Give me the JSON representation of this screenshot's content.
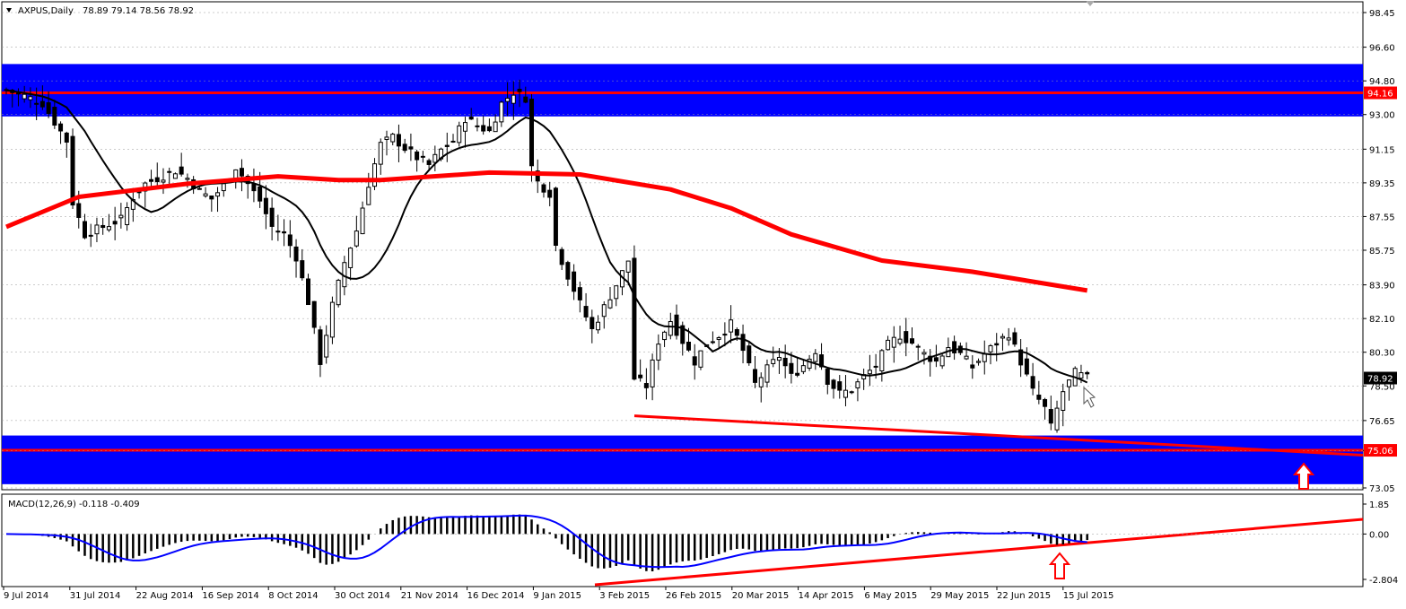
{
  "header": {
    "title": "AXPUS,Daily",
    "ohlc": "78.89 79.14 78.56 78.92",
    "macd_title": "MACD(12,26,9)",
    "macd_values": "-0.118 -0.409"
  },
  "colors": {
    "zone": "#0000ff",
    "sma_long": "#ff0000",
    "sma_short": "#000000",
    "trendline": "#ff0000",
    "macd_signal": "#0000ff",
    "histogram": "#000000",
    "arrow": "#ff0000"
  },
  "chart_data": [
    {
      "type": "candlestick",
      "name": "price",
      "ylim": [
        73.05,
        98.45
      ],
      "y_ticks": [
        "98.45",
        "96.60",
        "94.80",
        "93.00",
        "91.15",
        "89.35",
        "87.55",
        "85.75",
        "83.90",
        "82.10",
        "80.30",
        "78.50",
        "76.65",
        "75.05",
        "73.05"
      ],
      "x_ticks": [
        "9 Jul 2014",
        "31 Jul 2014",
        "22 Aug 2014",
        "16 Sep 2014",
        "8 Oct 2014",
        "30 Oct 2014",
        "21 Nov 2014",
        "16 Dec 2014",
        "9 Jan 2015",
        "3 Feb 2015",
        "26 Feb 2015",
        "20 Mar 2015",
        "14 Apr 2015",
        "6 May 2015",
        "29 May 2015",
        "22 Jun 2015",
        "15 Jul 2015"
      ],
      "last_price": "78.92",
      "levels": [
        {
          "label": "94.16",
          "value": 94.16,
          "zone": [
            92.9,
            95.7
          ]
        },
        {
          "label": "75.06",
          "value": 75.06,
          "zone": [
            73.25,
            75.85
          ]
        }
      ],
      "close_path": [
        [
          0,
          94.3
        ],
        [
          3,
          94.0
        ],
        [
          6,
          93.6
        ],
        [
          8,
          92.6
        ],
        [
          10,
          91.6
        ],
        [
          11,
          88.3
        ],
        [
          13,
          86.6
        ],
        [
          16,
          87.0
        ],
        [
          19,
          87.4
        ],
        [
          21,
          88.6
        ],
        [
          23,
          89.3
        ],
        [
          25,
          89.6
        ],
        [
          28,
          90.0
        ],
        [
          30,
          89.6
        ],
        [
          32,
          88.9
        ],
        [
          34,
          88.5
        ],
        [
          36,
          89.2
        ],
        [
          38,
          90.2
        ],
        [
          40,
          89.3
        ],
        [
          42,
          88.4
        ],
        [
          44,
          87.0
        ],
        [
          46,
          86.6
        ],
        [
          48,
          85.4
        ],
        [
          50,
          83.0
        ],
        [
          52,
          79.8
        ],
        [
          54,
          82.8
        ],
        [
          56,
          85.1
        ],
        [
          58,
          86.8
        ],
        [
          60,
          89.3
        ],
        [
          62,
          91.4
        ],
        [
          64,
          91.8
        ],
        [
          66,
          91.2
        ],
        [
          68,
          90.7
        ],
        [
          70,
          90.3
        ],
        [
          72,
          91.1
        ],
        [
          74,
          91.6
        ],
        [
          76,
          92.8
        ],
        [
          78,
          92.4
        ],
        [
          80,
          92.1
        ],
        [
          82,
          93.6
        ],
        [
          84,
          94.2
        ],
        [
          86,
          93.9
        ],
        [
          87,
          90.2
        ],
        [
          88,
          89.4
        ],
        [
          90,
          88.8
        ],
        [
          91,
          86.0
        ],
        [
          93,
          84.4
        ],
        [
          95,
          82.9
        ],
        [
          97,
          81.5
        ],
        [
          99,
          82.7
        ],
        [
          101,
          83.9
        ],
        [
          103,
          85.2
        ],
        [
          104,
          78.9
        ],
        [
          106,
          78.5
        ],
        [
          108,
          80.9
        ],
        [
          110,
          82.0
        ],
        [
          112,
          80.9
        ],
        [
          114,
          79.8
        ],
        [
          116,
          80.8
        ],
        [
          118,
          81.2
        ],
        [
          120,
          81.8
        ],
        [
          122,
          80.4
        ],
        [
          124,
          78.6
        ],
        [
          126,
          79.4
        ],
        [
          128,
          80.1
        ],
        [
          130,
          79.0
        ],
        [
          132,
          79.6
        ],
        [
          134,
          80.4
        ],
        [
          136,
          78.8
        ],
        [
          138,
          78.1
        ],
        [
          140,
          78.3
        ],
        [
          142,
          79.0
        ],
        [
          144,
          79.6
        ],
        [
          146,
          80.7
        ],
        [
          148,
          81.2
        ],
        [
          150,
          80.8
        ],
        [
          152,
          80.2
        ],
        [
          154,
          79.8
        ],
        [
          156,
          80.6
        ],
        [
          158,
          80.2
        ],
        [
          160,
          79.5
        ],
        [
          162,
          80.2
        ],
        [
          164,
          80.8
        ],
        [
          166,
          81.3
        ],
        [
          168,
          79.8
        ],
        [
          170,
          78.2
        ],
        [
          172,
          77.3
        ],
        [
          173,
          76.3
        ],
        [
          175,
          78.2
        ],
        [
          177,
          79.2
        ],
        [
          179,
          78.92
        ]
      ]
    },
    {
      "type": "macd",
      "name": "MACD",
      "ylim": [
        -2.804,
        1.85
      ],
      "y_ticks": [
        "1.85",
        "0.00",
        "-2.804"
      ],
      "value": -0.118,
      "signal": -0.409
    }
  ]
}
